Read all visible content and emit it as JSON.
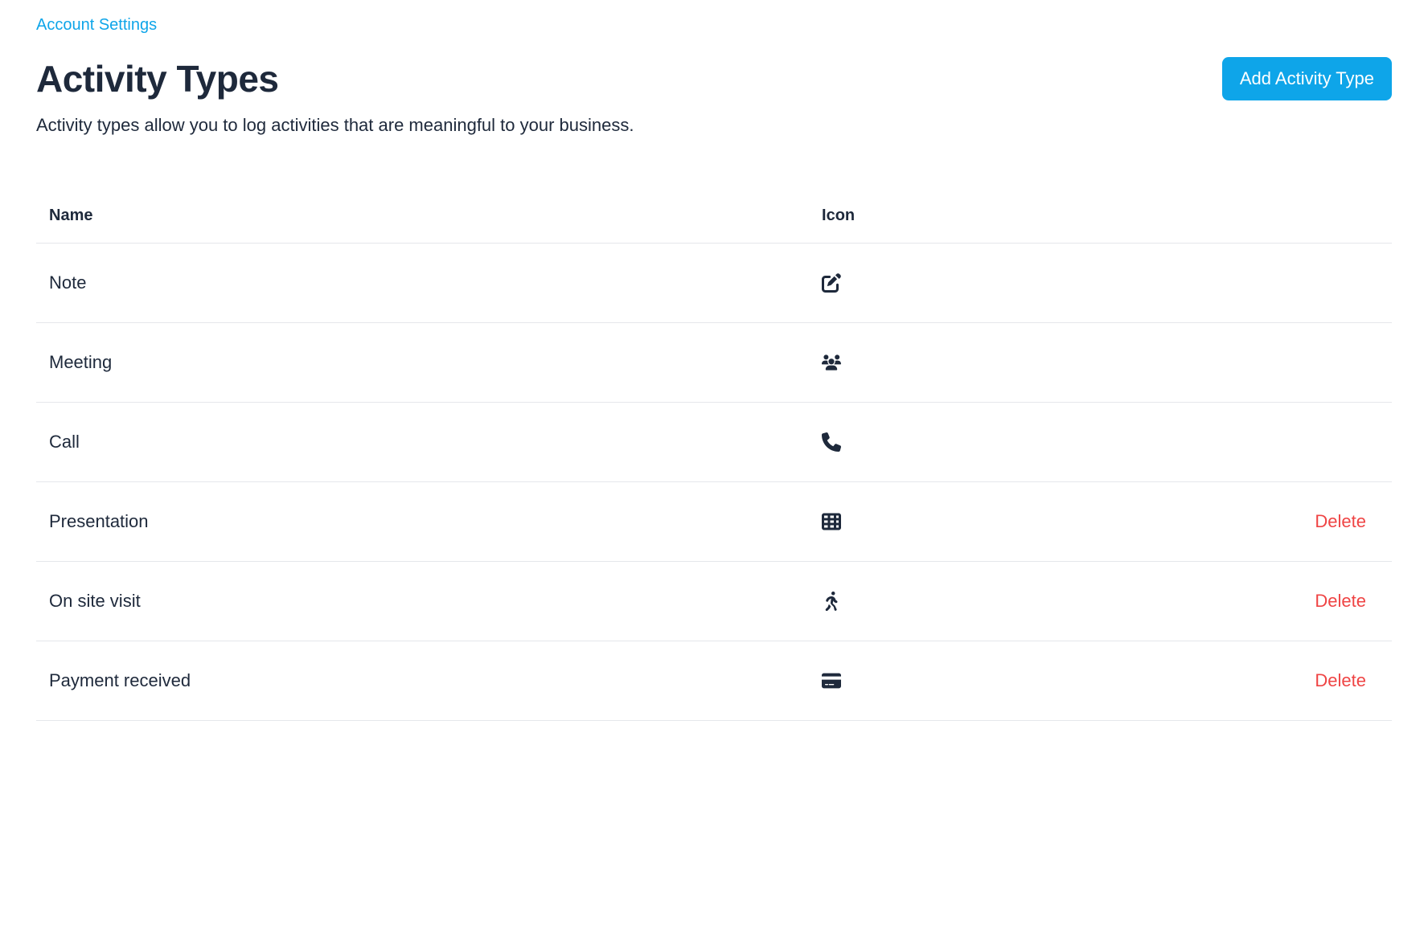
{
  "breadcrumb": "Account Settings",
  "title": "Activity Types",
  "description": "Activity types allow you to log activities that are meaningful to your business.",
  "add_button": "Add Activity Type",
  "columns": {
    "name": "Name",
    "icon": "Icon"
  },
  "delete_label": "Delete",
  "rows": [
    {
      "name": "Note",
      "icon": "note-icon",
      "deletable": false
    },
    {
      "name": "Meeting",
      "icon": "people-icon",
      "deletable": false
    },
    {
      "name": "Call",
      "icon": "phone-icon",
      "deletable": false
    },
    {
      "name": "Presentation",
      "icon": "table-icon",
      "deletable": true
    },
    {
      "name": "On site visit",
      "icon": "walking-icon",
      "deletable": true
    },
    {
      "name": "Payment received",
      "icon": "credit-card-icon",
      "deletable": true
    }
  ]
}
